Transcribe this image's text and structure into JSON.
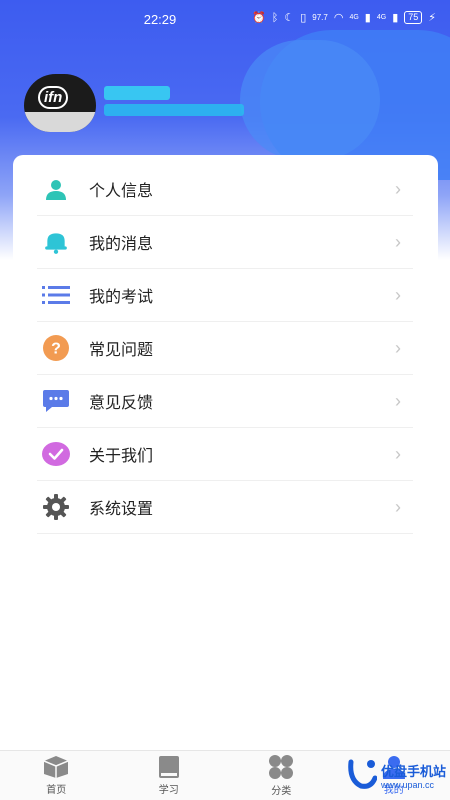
{
  "status_bar": {
    "time": "22:29",
    "net_speed": "97.7",
    "battery": "75",
    "signal_a": "4G",
    "signal_b": "4G"
  },
  "profile": {
    "avatar_logo": "ifn"
  },
  "menu": {
    "items": [
      {
        "label": "个人信息",
        "icon": "person-icon",
        "color": "#2ec4b6"
      },
      {
        "label": "我的消息",
        "icon": "bell-icon",
        "color": "#2ec4d6"
      },
      {
        "label": "我的考试",
        "icon": "list-icon",
        "color": "#5b7be8"
      },
      {
        "label": "常见问题",
        "icon": "question-icon",
        "color": "#f29b52"
      },
      {
        "label": "意见反馈",
        "icon": "feedback-icon",
        "color": "#5b7be8"
      },
      {
        "label": "关于我们",
        "icon": "about-icon",
        "color": "#d16ae0"
      },
      {
        "label": "系统设置",
        "icon": "gear-icon",
        "color": "#555555"
      }
    ],
    "chevron": "›"
  },
  "tabbar": {
    "tabs": [
      {
        "label": "首页",
        "icon": "home-icon"
      },
      {
        "label": "学习",
        "icon": "book-icon"
      },
      {
        "label": "分类",
        "icon": "category-icon"
      },
      {
        "label": "我的",
        "icon": "profile-icon"
      }
    ],
    "active_index": 3
  },
  "watermark": {
    "title": "优盘手机站",
    "url": "www.upan.cc"
  },
  "colors": {
    "header": "#3d5cf0",
    "accent": "#3b6cf0"
  }
}
